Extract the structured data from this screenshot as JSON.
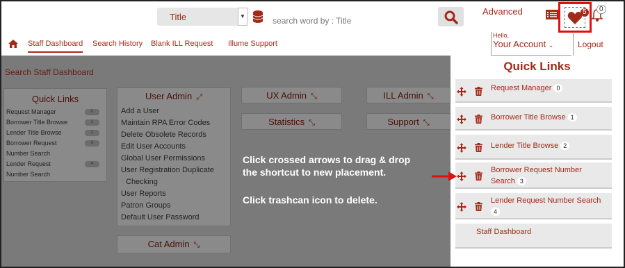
{
  "header": {
    "search_field": "Title",
    "search_placeholder": "search word by : Title",
    "advanced": "Advanced",
    "favorites_count": "5",
    "notifications_count": "0"
  },
  "nav": {
    "items": [
      "Staff Dashboard",
      "Search History",
      "Blank ILL Request",
      "Illume Support"
    ],
    "hello": "Hello,",
    "account": "Your Account",
    "logout": "Logout"
  },
  "page": {
    "title": "Search Staff Dashboard",
    "quick_links_card": {
      "title": "Quick Links",
      "rows": [
        {
          "label": "Request Manager",
          "badge": "0"
        },
        {
          "label": "Borrower Title Browse",
          "badge": "1"
        },
        {
          "label": "Lender Title Browse",
          "badge": "2"
        },
        {
          "label": "Borrower Request",
          "badge": "3"
        },
        {
          "label": "Number Search",
          "badge": ""
        },
        {
          "label": "Lender Request",
          "badge": "4"
        },
        {
          "label": "Number Search",
          "badge": ""
        }
      ]
    },
    "user_admin": {
      "title": "User Admin",
      "items": [
        "Add a User",
        "Maintain RPA Error Codes",
        "Delete Obsolete Records",
        "Edit User Accounts",
        "Global User Permissions",
        "User Registration Duplicate",
        "Checking",
        "User Reports",
        "Patron Groups",
        "Default User Password"
      ]
    },
    "cards": {
      "ux_admin": "UX Admin",
      "ill_admin": "ILL Admin",
      "statistics": "Statistics",
      "support": "Support",
      "cat_admin": "Cat Admin"
    }
  },
  "panel": {
    "title": "Quick Links",
    "links": [
      {
        "label": "Request Manager",
        "count": "0"
      },
      {
        "label": "Borrower Title Browse",
        "count": "1"
      },
      {
        "label": "Lender Title Browse",
        "count": "2"
      },
      {
        "label_line1": "Borrower Request Number",
        "label_line2": "Search",
        "count": "3"
      },
      {
        "label_line1": "Lender Request Number Search",
        "label_line2": "",
        "count": "4"
      },
      {
        "label": "Staff Dashboard"
      }
    ]
  },
  "annotation": {
    "line1": "Click crossed arrows to drag & drop",
    "line2": "the shortcut to new placement.",
    "line3": "Click trashcan icon to delete."
  },
  "colors": {
    "accent": "#a32a18",
    "highlight": "#e01010"
  }
}
